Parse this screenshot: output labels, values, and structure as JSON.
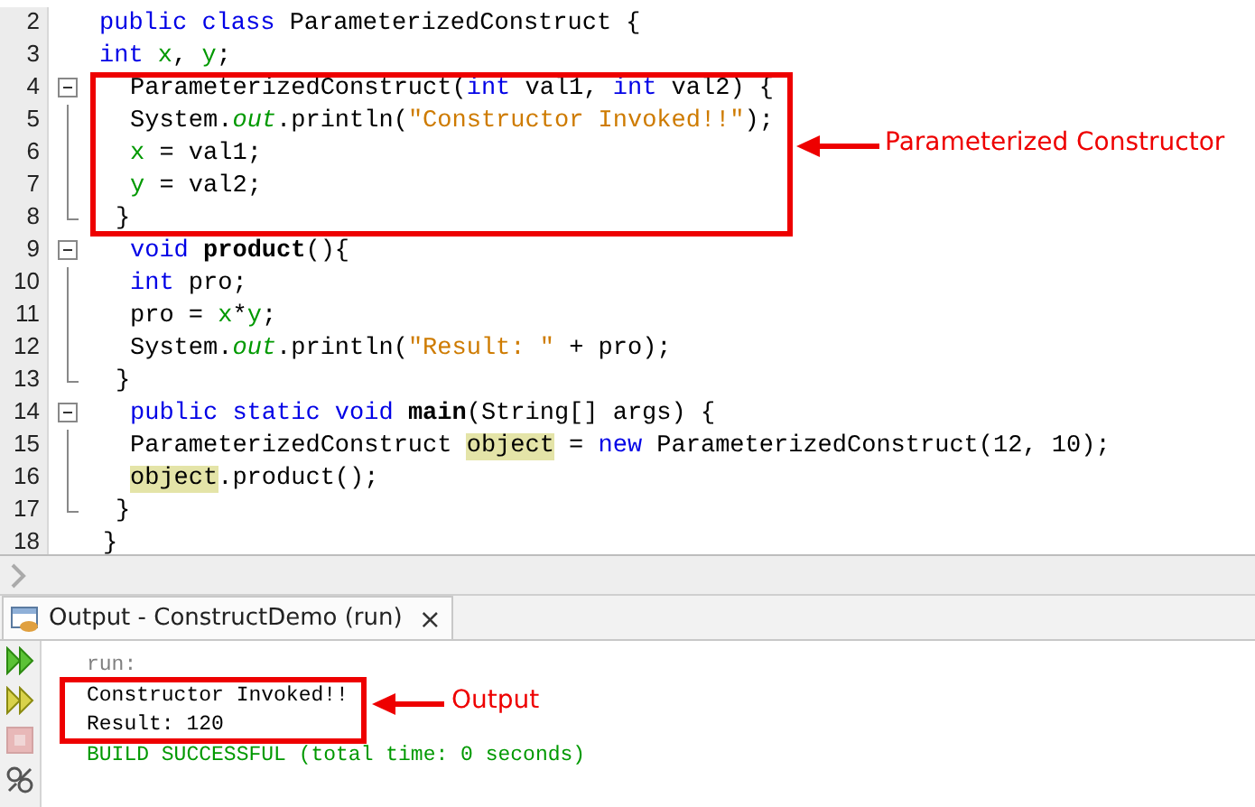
{
  "editor": {
    "lines": [
      {
        "number": "2",
        "kind": "top",
        "collapsible": false,
        "in_block": false,
        "tokens": [
          {
            "text": "public class",
            "kind": "keyword"
          },
          {
            "text": " ParameterizedConstruct {",
            "kind": "plain"
          }
        ]
      },
      {
        "number": "3",
        "kind": "top",
        "collapsible": false,
        "in_block": false,
        "tokens": [
          {
            "text": "int ",
            "kind": "keyword"
          },
          {
            "text": "x",
            "kind": "field"
          },
          {
            "text": ", ",
            "kind": "plain"
          },
          {
            "text": "y",
            "kind": "field"
          },
          {
            "text": ";",
            "kind": "plain"
          }
        ]
      },
      {
        "number": "4",
        "kind": "body",
        "collapsible": true,
        "tokens": [
          {
            "text": "ParameterizedConstruct(",
            "kind": "plain"
          },
          {
            "text": "int",
            "kind": "keyword"
          },
          {
            "text": " val1, ",
            "kind": "plain"
          },
          {
            "text": "int",
            "kind": "keyword"
          },
          {
            "text": " val2) {",
            "kind": "plain"
          }
        ]
      },
      {
        "number": "5",
        "kind": "body",
        "collapsible": false,
        "in_block": true,
        "block_end": false,
        "tokens": [
          {
            "text": "System.",
            "kind": "plain"
          },
          {
            "text": "out",
            "kind": "field-italic"
          },
          {
            "text": ".println(",
            "kind": "plain"
          },
          {
            "text": "\"Constructor Invoked!!\"",
            "kind": "string"
          },
          {
            "text": ");",
            "kind": "plain"
          }
        ]
      },
      {
        "number": "6",
        "kind": "body",
        "collapsible": false,
        "in_block": true,
        "block_end": false,
        "tokens": [
          {
            "text": "x",
            "kind": "field"
          },
          {
            "text": " = val1;",
            "kind": "plain"
          }
        ]
      },
      {
        "number": "7",
        "kind": "body",
        "collapsible": false,
        "in_block": true,
        "block_end": false,
        "tokens": [
          {
            "text": "y",
            "kind": "field"
          },
          {
            "text": " = val2;",
            "kind": "plain"
          }
        ]
      },
      {
        "number": "8",
        "kind": "close",
        "collapsible": false,
        "in_block": true,
        "block_end": true,
        "tokens": [
          {
            "text": "}",
            "kind": "plain"
          }
        ]
      },
      {
        "number": "9",
        "kind": "body",
        "collapsible": true,
        "tokens": [
          {
            "text": "void ",
            "kind": "keyword"
          },
          {
            "text": "product",
            "kind": "bold"
          },
          {
            "text": "(){",
            "kind": "plain"
          }
        ]
      },
      {
        "number": "10",
        "kind": "body",
        "collapsible": false,
        "in_block": true,
        "block_end": false,
        "tokens": [
          {
            "text": "int",
            "kind": "keyword"
          },
          {
            "text": " pro;",
            "kind": "plain"
          }
        ]
      },
      {
        "number": "11",
        "kind": "body",
        "collapsible": false,
        "in_block": true,
        "block_end": false,
        "tokens": [
          {
            "text": "pro = ",
            "kind": "plain"
          },
          {
            "text": "x",
            "kind": "field"
          },
          {
            "text": "*",
            "kind": "plain"
          },
          {
            "text": "y",
            "kind": "field"
          },
          {
            "text": ";",
            "kind": "plain"
          }
        ]
      },
      {
        "number": "12",
        "kind": "body",
        "collapsible": false,
        "in_block": true,
        "block_end": false,
        "tokens": [
          {
            "text": "System.",
            "kind": "plain"
          },
          {
            "text": "out",
            "kind": "field-italic"
          },
          {
            "text": ".println(",
            "kind": "plain"
          },
          {
            "text": "\"Result: \"",
            "kind": "string"
          },
          {
            "text": " + pro);",
            "kind": "plain"
          }
        ]
      },
      {
        "number": "13",
        "kind": "close",
        "collapsible": false,
        "in_block": true,
        "block_end": true,
        "tokens": [
          {
            "text": "}",
            "kind": "plain"
          }
        ]
      },
      {
        "number": "14",
        "kind": "body",
        "collapsible": true,
        "tokens": [
          {
            "text": "public static void ",
            "kind": "keyword"
          },
          {
            "text": "main",
            "kind": "bold"
          },
          {
            "text": "(String[] args) {",
            "kind": "plain"
          }
        ]
      },
      {
        "number": "15",
        "kind": "body",
        "collapsible": false,
        "in_block": true,
        "block_end": false,
        "tokens": [
          {
            "text": "ParameterizedConstruct ",
            "kind": "plain"
          },
          {
            "text": "object",
            "kind": "highlight"
          },
          {
            "text": " = ",
            "kind": "plain"
          },
          {
            "text": "new",
            "kind": "keyword"
          },
          {
            "text": " ParameterizedConstruct(12, 10);",
            "kind": "plain"
          }
        ]
      },
      {
        "number": "16",
        "kind": "body",
        "collapsible": false,
        "in_block": true,
        "block_end": false,
        "tokens": [
          {
            "text": "object",
            "kind": "highlight"
          },
          {
            "text": ".product();",
            "kind": "plain"
          }
        ]
      },
      {
        "number": "17",
        "kind": "close",
        "collapsible": false,
        "in_block": true,
        "block_end": true,
        "tokens": [
          {
            "text": "}",
            "kind": "plain"
          }
        ]
      },
      {
        "number": "18",
        "kind": "end",
        "collapsible": false,
        "in_block": false,
        "tokens": [
          {
            "text": "}",
            "kind": "plain"
          }
        ]
      }
    ],
    "annotation": {
      "label": "Parameterized Constructor"
    }
  },
  "output": {
    "tab": {
      "title": "Output - ConstructDemo (run)",
      "close": "×",
      "selected": true
    },
    "toolbar": [
      {
        "kind": "rerun",
        "disabled": false
      },
      {
        "kind": "rerun-options",
        "disabled": false
      },
      {
        "kind": "stop",
        "disabled": true
      },
      {
        "kind": "settings",
        "disabled": false
      }
    ],
    "lines": [
      {
        "text": "run:",
        "kind": "info"
      },
      {
        "text": "Constructor Invoked!!",
        "kind": "plain"
      },
      {
        "text": "Result: 120",
        "kind": "plain"
      },
      {
        "text": "BUILD SUCCESSFUL (total time: 0 seconds)",
        "kind": "success"
      }
    ],
    "annotation": {
      "label": "Output"
    }
  }
}
